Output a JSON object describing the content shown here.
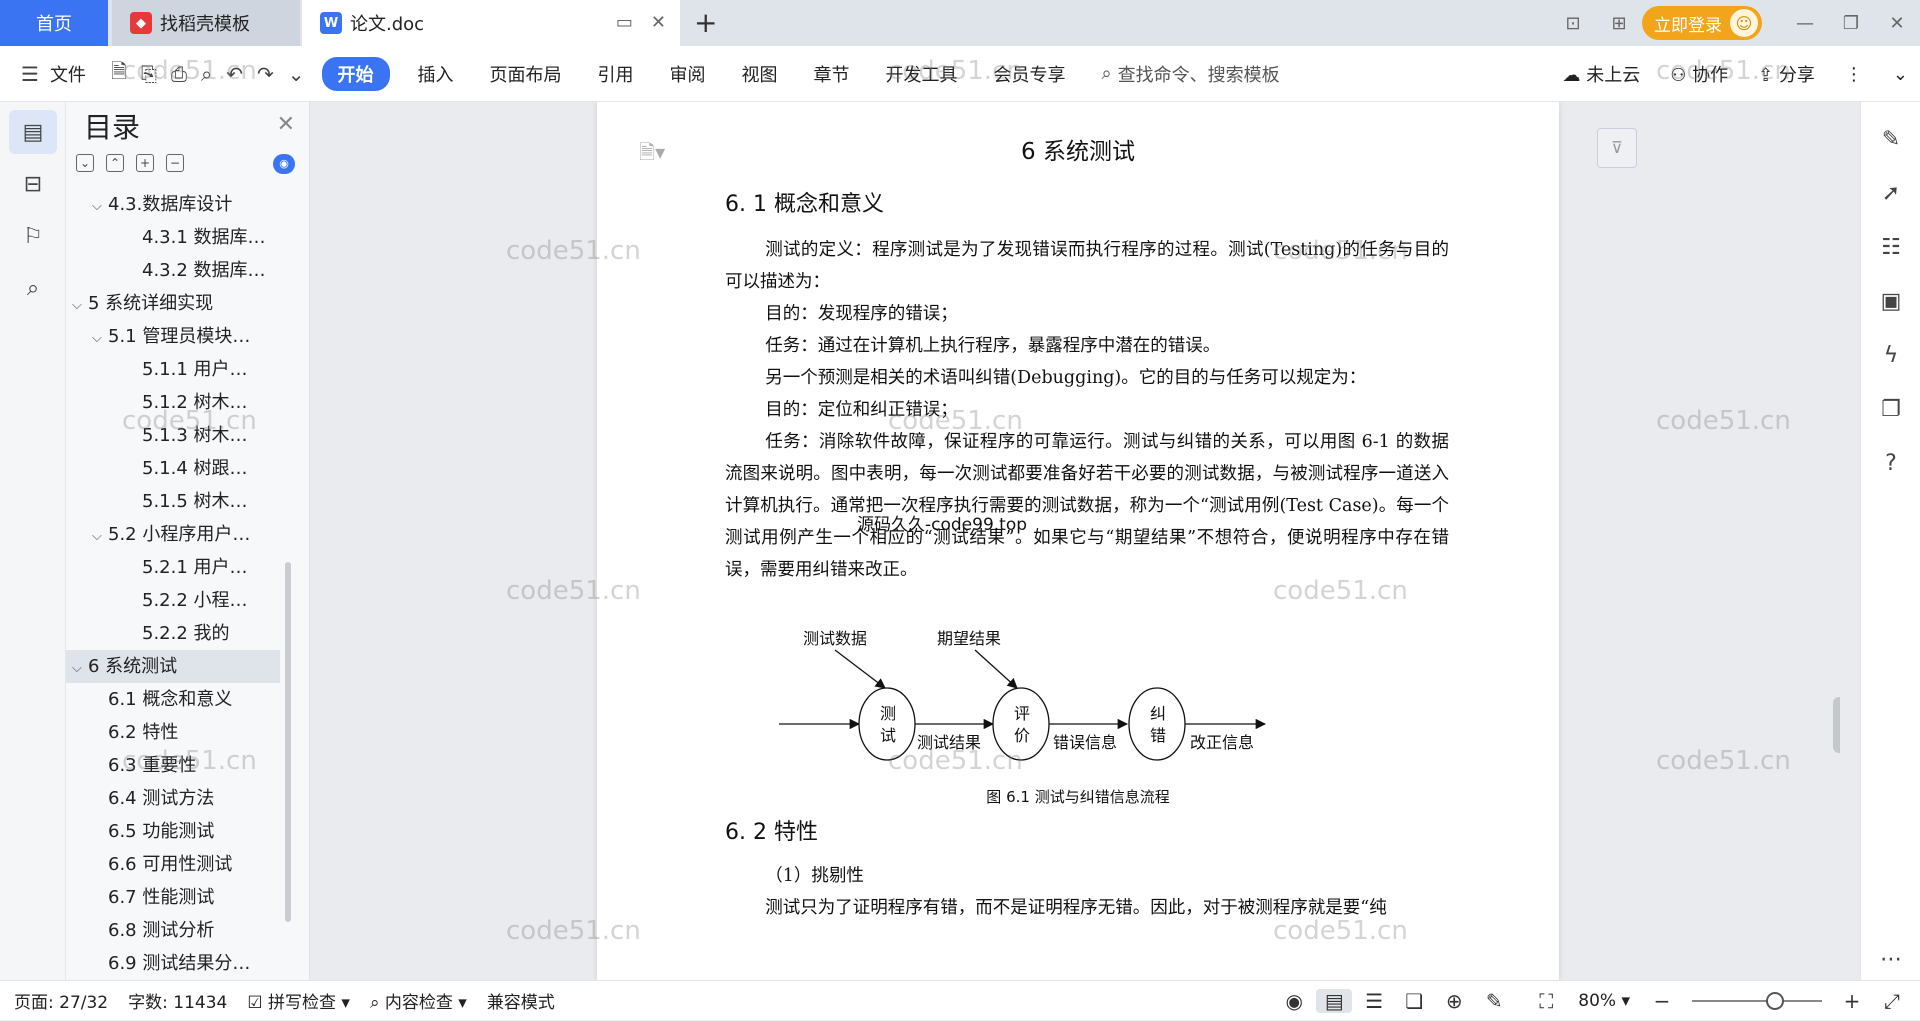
{
  "titlebar": {
    "home_tab": "首页",
    "docer_tab": "找稻壳模板",
    "doc_tab": "论文.doc",
    "login": "立即登录"
  },
  "toolbar": {
    "file": "文件",
    "tabs": [
      "开始",
      "插入",
      "页面布局",
      "引用",
      "审阅",
      "视图",
      "章节",
      "开发工具",
      "会员专享"
    ],
    "search_placeholder": "查找命令、搜索模板",
    "cloud": "未上云",
    "collab": "协作",
    "share": "分享"
  },
  "toc": {
    "title": "目录",
    "items": [
      {
        "label": "4.3.数据库设计",
        "level": 2,
        "caret": "⌵"
      },
      {
        "label": "4.3.1 数据库…",
        "level": 3,
        "caret": ""
      },
      {
        "label": "4.3.2 数据库…",
        "level": 3,
        "caret": ""
      },
      {
        "label": "5 系统详细实现",
        "level": 1,
        "caret": "⌵"
      },
      {
        "label": "5.1  管理员模块…",
        "level": 2,
        "caret": "⌵"
      },
      {
        "label": "5.1.1  用户…",
        "level": 3,
        "caret": ""
      },
      {
        "label": "5.1.2  树木…",
        "level": 3,
        "caret": ""
      },
      {
        "label": "5.1.3  树木…",
        "level": 3,
        "caret": ""
      },
      {
        "label": "5.1.4  树跟…",
        "level": 3,
        "caret": ""
      },
      {
        "label": "5.1.5  树木…",
        "level": 3,
        "caret": ""
      },
      {
        "label": "5.2  小程序用户…",
        "level": 2,
        "caret": "⌵"
      },
      {
        "label": "5.2.1  用户…",
        "level": 3,
        "caret": ""
      },
      {
        "label": "5.2.2  小程…",
        "level": 3,
        "caret": ""
      },
      {
        "label": "5.2.2  我的",
        "level": 3,
        "caret": ""
      },
      {
        "label": "6 系统测试",
        "level": 1,
        "caret": "⌵",
        "selected": true
      },
      {
        "label": "6.1 概念和意义",
        "level": 2,
        "caret": ""
      },
      {
        "label": "6.2 特性",
        "level": 2,
        "caret": ""
      },
      {
        "label": "6.3 重要性",
        "level": 2,
        "caret": ""
      },
      {
        "label": "6.4 测试方法",
        "level": 2,
        "caret": ""
      },
      {
        "label": "6.5  功能测试",
        "level": 2,
        "caret": ""
      },
      {
        "label": "6.6 可用性测试",
        "level": 2,
        "caret": ""
      },
      {
        "label": "6.7 性能测试",
        "level": 2,
        "caret": ""
      },
      {
        "label": "6.8 测试分析",
        "level": 2,
        "caret": ""
      },
      {
        "label": "6.9 测试结果分…",
        "level": 2,
        "caret": ""
      }
    ]
  },
  "document": {
    "chapter_title": "6 系统测试",
    "section1": "6. 1 概念和意义",
    "paragraphs": [
      "测试的定义：程序测试是为了发现错误而执行程序的过程。测试(Testing)的任务与目的可以描述为：",
      "目的：发现程序的错误；",
      "任务：通过在计算机上执行程序，暴露程序中潜在的错误。",
      "另一个预测是相关的术语叫纠错(Debugging)。它的目的与任务可以规定为：",
      "目的：定位和纠正错误；",
      "任务：消除软件故障，保证程序的可靠运行。测试与纠错的关系，可以用图 6-1 的数据流图来说明。图中表明，每一次测试都要准备好若干必要的测试数据，与被测试程序一道送入计算机执行。通常把一次程序执行需要的测试数据，称为一个“测试用例(Test Case)。每一个测试用例产生一个相应的“测试结果”。如果它与“期望结果”不想符合，便说明程序中存在错误，需要用纠错来改正。"
    ],
    "overlay_text": "源码久久-code99.top",
    "diagram": {
      "test_data": "测试数据",
      "expected": "期望结果",
      "node1": [
        "测",
        "试"
      ],
      "node2": [
        "评",
        "价"
      ],
      "node3": [
        "纠",
        "错"
      ],
      "edge1": "测试结果",
      "edge2": "错误信息",
      "edge3": "改正信息"
    },
    "figure_caption": "图 6.1 测试与纠错信息流程",
    "section2": "6. 2 特性",
    "sub1": "（1）挑剔性",
    "cut_line": "测试只为了证明程序有错，而不是证明程序无错。因此，对于被测程序就是要“纯"
  },
  "watermark": "code51.cn",
  "statusbar": {
    "page": "页面: 27/32",
    "words": "字数: 11434",
    "spell": "拼写检查",
    "content_check": "内容检查",
    "compat": "兼容模式",
    "zoom": "80%"
  }
}
